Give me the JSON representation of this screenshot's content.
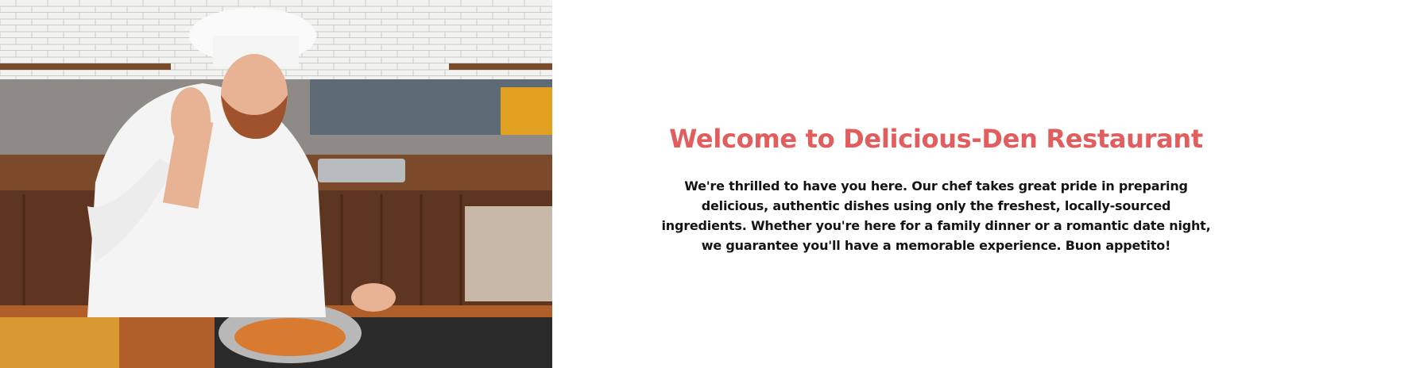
{
  "hero": {
    "title": "Welcome to Delicious-Den Restaurant",
    "text": "We're thrilled to have you here. Our chef takes great pride in preparing delicious, authentic dishes using only the freshest, locally-sourced ingredients. Whether you're here for a family dinner or a romantic date night, we guarantee you'll have a memorable experience. Buon appetito!",
    "title_color": "#e25d5d"
  }
}
